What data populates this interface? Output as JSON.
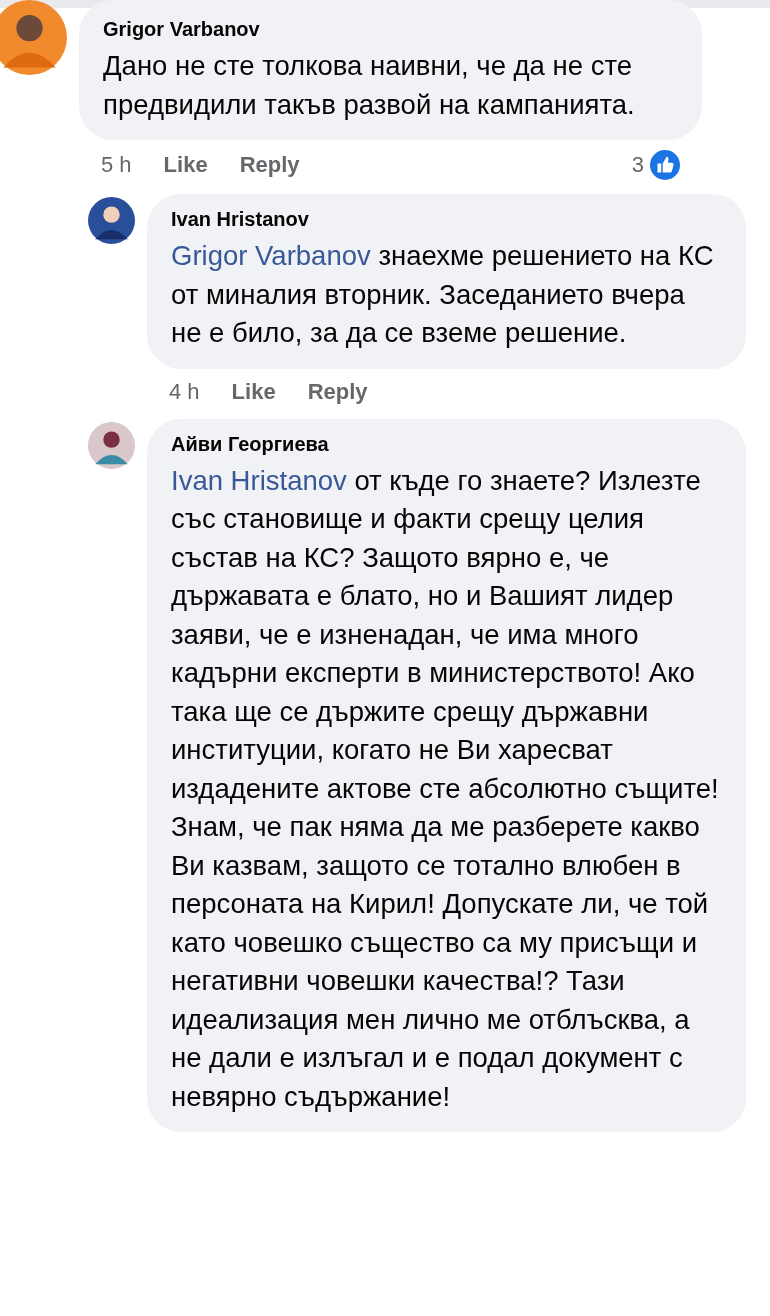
{
  "comments": [
    {
      "author": "Grigor Varbanov",
      "text": "Дано не сте толкова наивни, че да не сте предвидили такъв развой на кампанията.",
      "time": "5 h",
      "actions": [
        "Like",
        "Reply"
      ],
      "reactions": {
        "count": "3"
      },
      "children": [
        {
          "author": "Ivan Hristanov",
          "mention": "Grigor Varbanov",
          "text": "знаехме решението на КС от миналия вторник. Заседанието вчера не е било, за да се вземе решение.",
          "time": "4 h",
          "actions": [
            "Like",
            "Reply"
          ]
        },
        {
          "author": "Айви Георгиева",
          "mention": "Ivan Hristanov",
          "text": "от къде го знаете? Излезте със становище и факти срещу целия състав на КС? Защото вярно е, че държавата е блато, но и Вашият лидер заяви, че е изненадан, че има много кадърни експерти в министерството! Ако така ще се държите срещу държавни институции, когато не Ви харесват издадените актове сте абсолютно същите! Знам, че пак няма да ме разберете какво Ви казвам, защото се тотално влюбен в персоната на Кирил! Допускате ли, че той като човешко същество са му присъщи и негативни човешки качества!? Тази идеализация мен лично ме отблъсква, а не дали е излъгал и е подал документ с невярно съдържание!"
        }
      ]
    }
  ]
}
